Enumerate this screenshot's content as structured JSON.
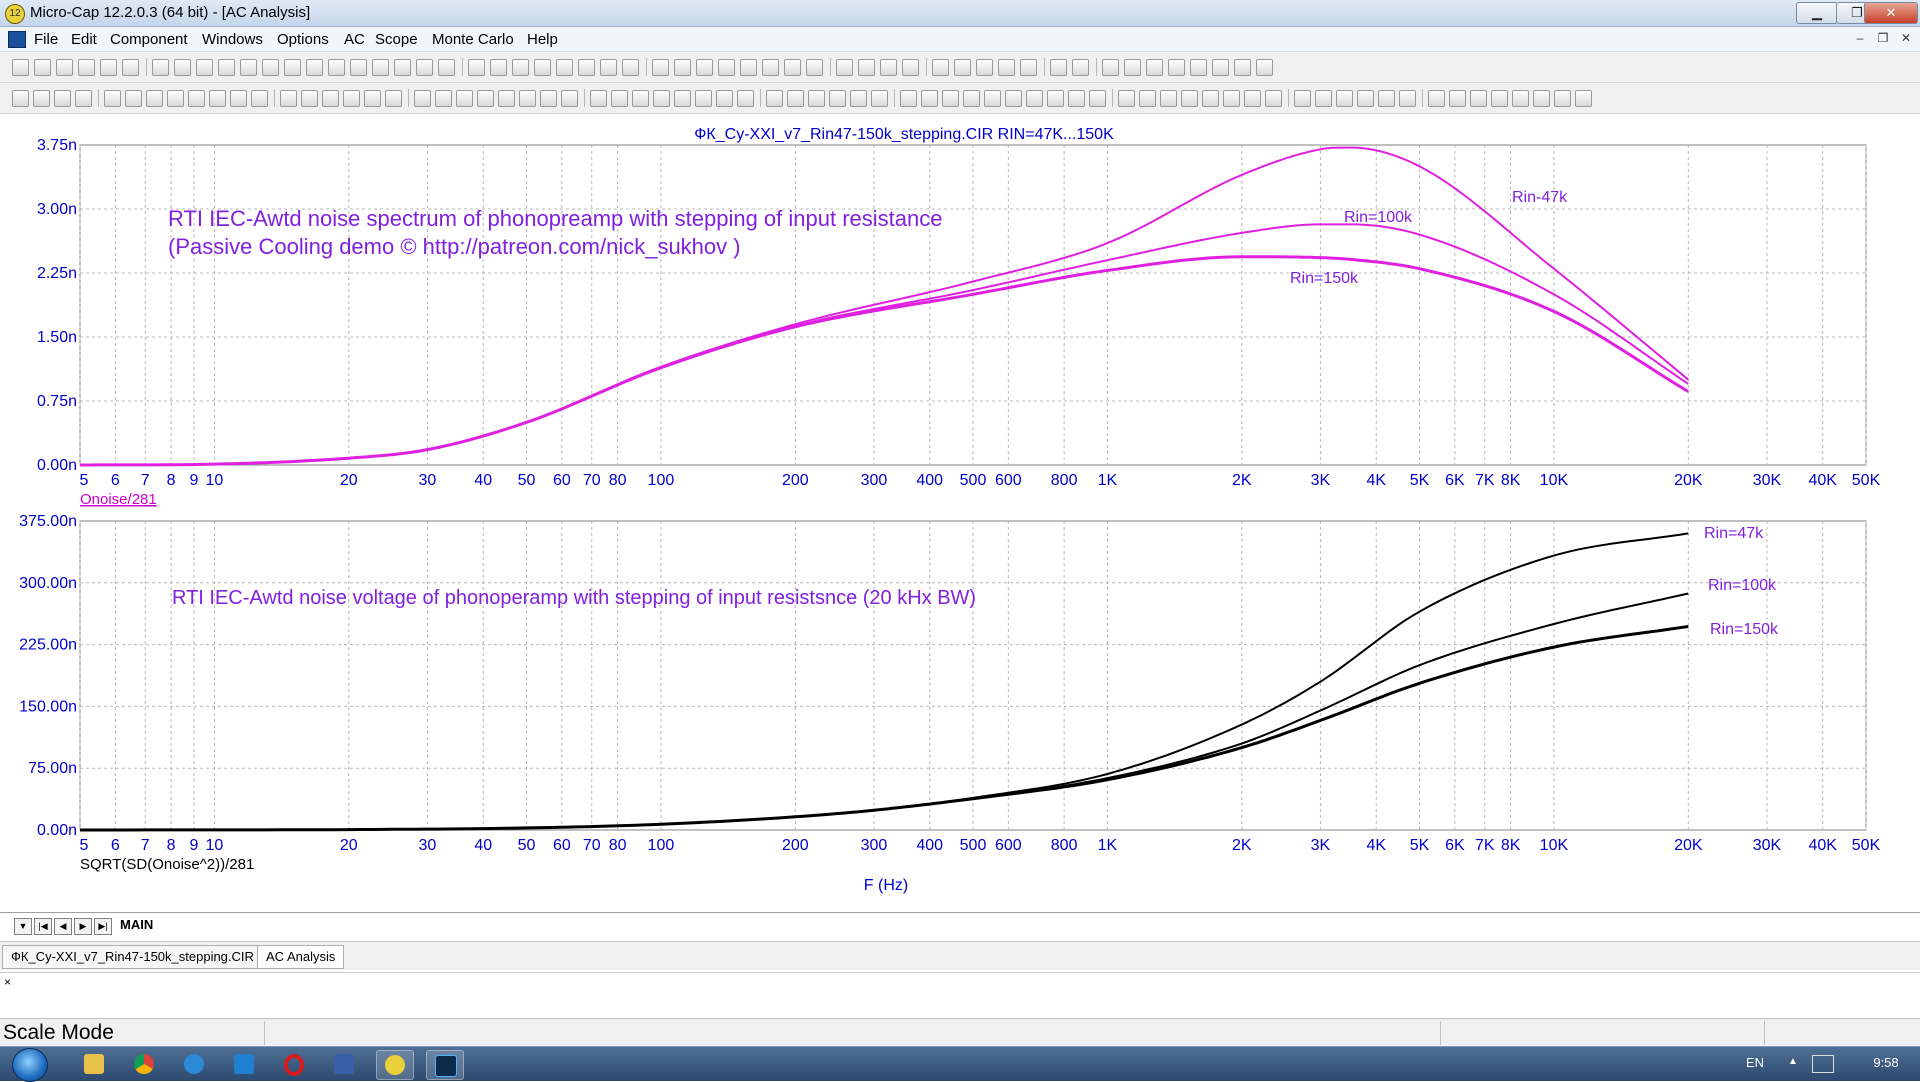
{
  "window": {
    "title": "Micro-Cap 12.2.0.3 (64 bit) - [AC Analysis]",
    "app_icon": "micro-cap-icon",
    "minimize_label": "▁",
    "restore_label": "❐",
    "close_label": "✕"
  },
  "menu": {
    "items": [
      "File",
      "Edit",
      "Component",
      "Windows",
      "Options",
      "AC",
      "Scope",
      "Monte Carlo",
      "Help"
    ],
    "mdi_minimize": "–",
    "mdi_restore": "❐",
    "mdi_close": "✕"
  },
  "plot": {
    "header": "ФК_Cy-XXI_v7_Rin47-150k_stepping.CIR RIN=47K...150K",
    "x_axis_title": "F (Hz)",
    "x_ticks": [
      "5",
      "6",
      "7",
      "8",
      "9",
      "10",
      "20",
      "30",
      "40",
      "50",
      "60",
      "70",
      "80",
      "100",
      "200",
      "300",
      "400",
      "500",
      "600",
      "800",
      "1K",
      "2K",
      "3K",
      "4K",
      "5K",
      "6K",
      "7K",
      "8K",
      "10K",
      "20K",
      "30K",
      "40K",
      "50K"
    ],
    "top": {
      "y_ticks": [
        "0.00n",
        "0.75n",
        "1.50n",
        "2.25n",
        "3.00n",
        "3.75n"
      ],
      "expression": "Onoise/281",
      "annotation_line1": "RTI IEC-Awtd noise spectrum of phonopreamp with stepping of input resistance",
      "annotation_line2": "(Passive Cooling demo © http://patreon.com/nick_sukhov )",
      "label_47k": "Rin-47k",
      "label_100k": "Rin=100k",
      "label_150k": "Rin=150k",
      "curve_color": "#e020e0"
    },
    "bottom": {
      "y_ticks": [
        "0.00n",
        "75.00n",
        "150.00n",
        "225.00n",
        "300.00n",
        "375.00n"
      ],
      "expression": "SQRT(SD(Onoise^2))/281",
      "annotation": "RTI IEC-Awtd noise voltage of phonoperamp with stepping of input resistsnce (20 kHx BW)",
      "label_47k": "Rin=47k",
      "label_100k": "Rin=100k",
      "label_150k": "Rin=150k",
      "curve_color": "#000000"
    },
    "axis_label_color": "#0000cc",
    "annotation_color": "#8020e0"
  },
  "chart_data": [
    {
      "type": "line",
      "x_scale": "log",
      "xlim": [
        5,
        50000
      ],
      "ylim": [
        0,
        3.75
      ],
      "y_unit": "n",
      "grid": true,
      "x": [
        5,
        10,
        20,
        30,
        50,
        100,
        200,
        500,
        1000,
        2000,
        3000,
        3500,
        5000,
        10000,
        20000
      ],
      "series": [
        {
          "name": "Rin-47k",
          "values": [
            0.0,
            0.01,
            0.08,
            0.18,
            0.5,
            1.15,
            1.65,
            2.15,
            2.6,
            3.4,
            3.7,
            3.72,
            3.5,
            2.3,
            1.0
          ]
        },
        {
          "name": "Rin=100k",
          "values": [
            0.0,
            0.01,
            0.08,
            0.18,
            0.5,
            1.15,
            1.63,
            2.05,
            2.4,
            2.72,
            2.82,
            2.82,
            2.7,
            2.0,
            0.95
          ]
        },
        {
          "name": "Rin=150k",
          "values": [
            0.0,
            0.01,
            0.08,
            0.18,
            0.5,
            1.14,
            1.62,
            2.0,
            2.28,
            2.44,
            2.43,
            2.41,
            2.3,
            1.8,
            0.86
          ]
        }
      ]
    },
    {
      "type": "line",
      "x_scale": "log",
      "xlim": [
        5,
        50000
      ],
      "ylim": [
        0,
        375
      ],
      "y_unit": "n",
      "grid": true,
      "x": [
        5,
        20,
        50,
        100,
        200,
        300,
        500,
        1000,
        2000,
        3000,
        5000,
        10000,
        20000
      ],
      "series": [
        {
          "name": "Rin=47k",
          "values": [
            0.0,
            0.5,
            2.5,
            7,
            16,
            24,
            39,
            68,
            128,
            180,
            265,
            333,
            360
          ]
        },
        {
          "name": "Rin=100k",
          "values": [
            0.0,
            0.5,
            2.5,
            7,
            16,
            24,
            38,
            63,
            105,
            145,
            200,
            250,
            287
          ]
        },
        {
          "name": "Rin=150k",
          "values": [
            0.0,
            0.5,
            2.5,
            7,
            16,
            24,
            38,
            61,
            100,
            133,
            178,
            222,
            247
          ]
        }
      ]
    }
  ],
  "sheet_tabs": {
    "main_label": "MAIN"
  },
  "doc_tabs": [
    "ФК_Cy-XXI_v7_Rin47-150k_stepping.CIR",
    "AC Analysis"
  ],
  "command": {
    "close_label": "×"
  },
  "status": {
    "mode": "Scale Mode"
  },
  "taskbar": {
    "language": "EN",
    "clock": "9:58",
    "apps": [
      "explorer-icon",
      "chrome-icon",
      "ie-icon",
      "store-icon",
      "opera-icon",
      "save-icon",
      "micro-cap-icon",
      "photoshop-icon"
    ]
  }
}
